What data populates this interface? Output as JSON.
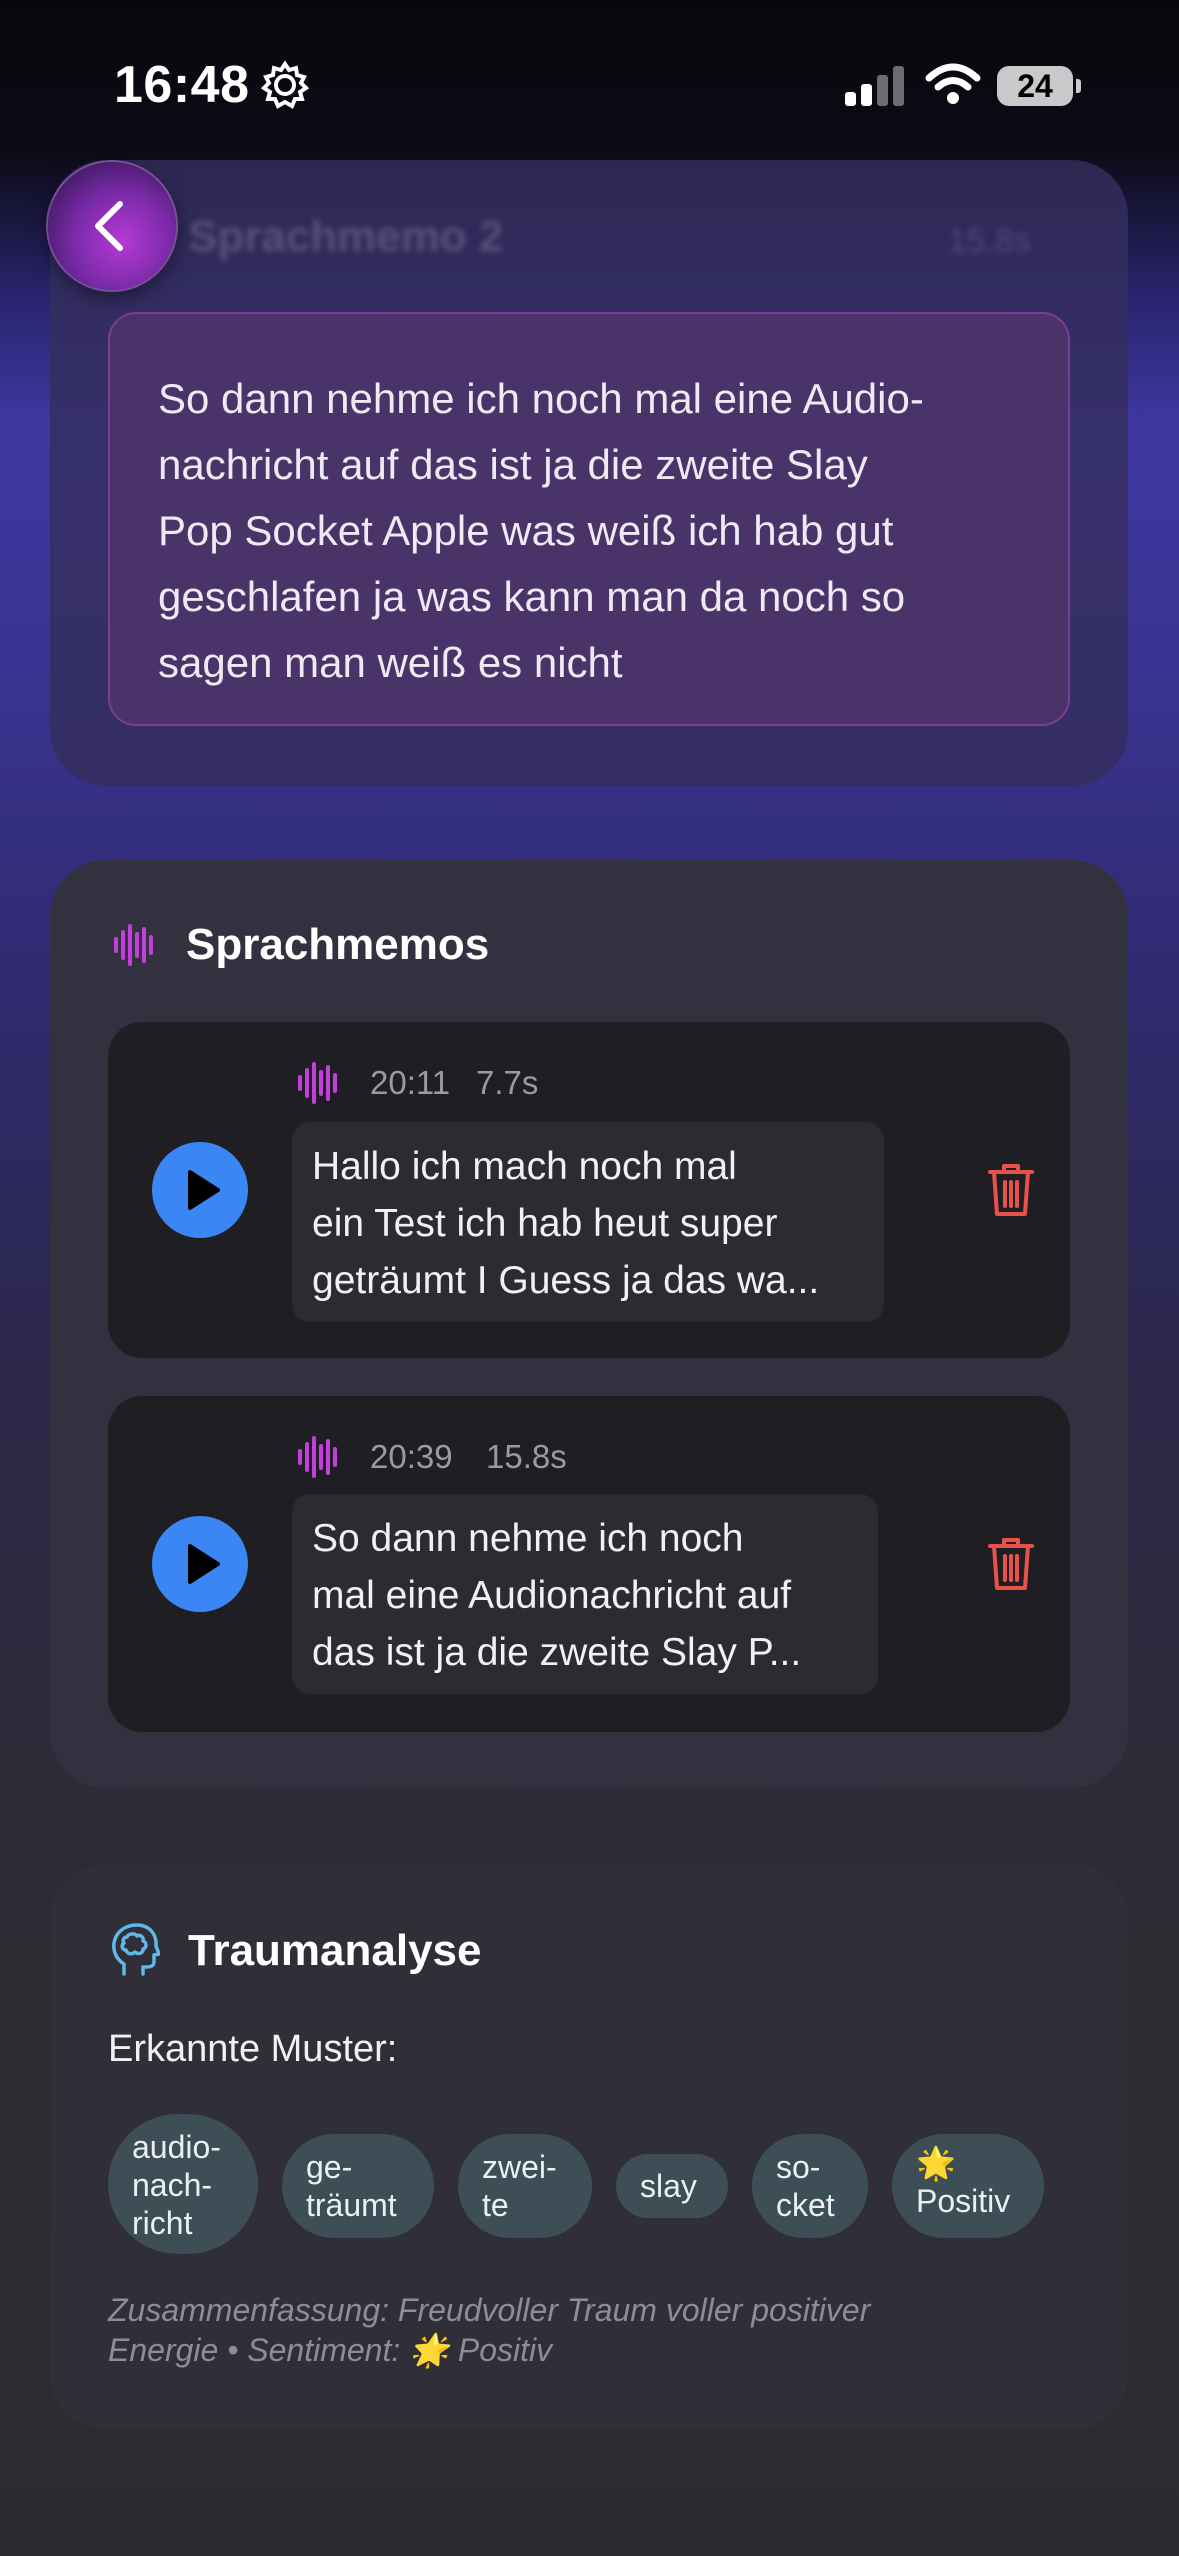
{
  "status_bar": {
    "time": "16:48",
    "battery": "24"
  },
  "header": {
    "title": "Sprachmemo 2",
    "duration": "15.8s"
  },
  "transcript": {
    "lines": [
      "So dann nehme ich noch mal eine Audio-",
      "nachricht auf das ist ja die zweite Slay",
      "Pop Socket Apple was weiß ich hab gut",
      "geschlafen ja was kann man da noch so",
      "sagen man weiß es nicht"
    ]
  },
  "voice_memos": {
    "title": "Sprachmemos",
    "items": [
      {
        "time": "20:11",
        "duration": "7.7s",
        "lines": [
          "Hallo ich mach noch mal",
          "ein Test ich hab heut super",
          "geträumt I Guess ja das wa..."
        ]
      },
      {
        "time": "20:39",
        "duration": "15.8s",
        "lines": [
          "So dann nehme ich noch",
          "mal eine Audionachricht auf",
          "das ist ja die zweite Slay P..."
        ]
      }
    ]
  },
  "analysis": {
    "title": "Traumanalyse",
    "patterns_label": "Erkannte Muster:",
    "chips": [
      {
        "lines": [
          "audio-",
          "nach-",
          "richt"
        ]
      },
      {
        "lines": [
          "ge-",
          "träumt"
        ]
      },
      {
        "lines": [
          "zwei-",
          "te"
        ]
      },
      {
        "lines": [
          "slay"
        ]
      },
      {
        "lines": [
          "so-",
          "cket"
        ]
      },
      {
        "lines": [
          "🌟",
          "Positiv"
        ]
      }
    ],
    "summary_line1": "Zusammenfassung: Freudvoller Traum voller positiver",
    "summary_line2": "Energie • Sentiment: 🌟 Positiv"
  },
  "colors": {
    "accent_purple": "#c23fdc",
    "play_blue": "#3b86f5",
    "delete_red": "#e8524a",
    "brain_cyan": "#5fb8e8"
  },
  "icons": [
    "gear-icon",
    "signal-icon",
    "wifi-icon",
    "battery-icon",
    "chevron-left-icon",
    "waveform-icon",
    "play-icon",
    "trash-icon",
    "brain-icon"
  ]
}
